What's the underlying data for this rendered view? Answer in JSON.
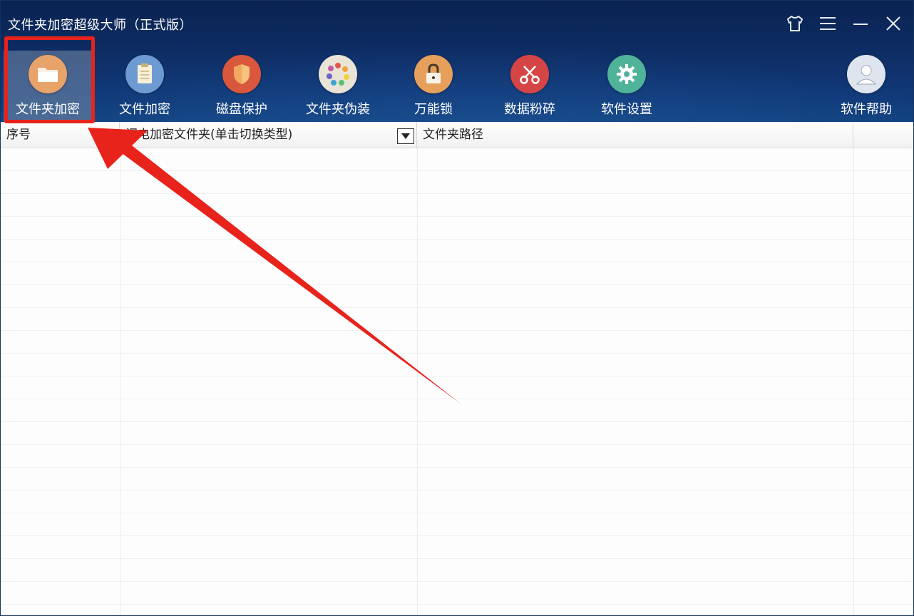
{
  "window": {
    "title": "文件夹加密超级大师（正式版）"
  },
  "window_controls": [
    {
      "icon": "tshirt-icon",
      "name": "skin-button"
    },
    {
      "icon": "menu-icon",
      "name": "menu-button"
    },
    {
      "icon": "minimize-icon",
      "name": "minimize-button"
    },
    {
      "icon": "close-icon",
      "name": "close-button"
    }
  ],
  "toolbar": {
    "items": [
      {
        "label": "文件夹加密",
        "icon": "folder-icon",
        "color": "#e8a36a",
        "active": true
      },
      {
        "label": "文件加密",
        "icon": "document-icon",
        "color": "#6d9bd1"
      },
      {
        "label": "磁盘保护",
        "icon": "shield-icon",
        "color": "#d9573c"
      },
      {
        "label": "文件夹伪装",
        "icon": "color-wheel-icon",
        "color": "#e9e4d6"
      },
      {
        "label": "万能锁",
        "icon": "lock-icon",
        "color": "#e6a05c"
      },
      {
        "label": "数据粉碎",
        "icon": "scissors-icon",
        "color": "#d64545"
      },
      {
        "label": "软件设置",
        "icon": "gear-icon",
        "color": "#4fb39a"
      },
      {
        "label": "软件帮助",
        "icon": "user-icon",
        "color": "#dfe5ee"
      }
    ]
  },
  "table": {
    "columns": [
      {
        "label": "序号"
      },
      {
        "label": "闪电加密文件夹(单击切换类型)"
      },
      {
        "label": "文件夹路径"
      }
    ],
    "rows": []
  },
  "colors": {
    "header_bg": "#0e2c63",
    "highlight": "#e8231c"
  }
}
